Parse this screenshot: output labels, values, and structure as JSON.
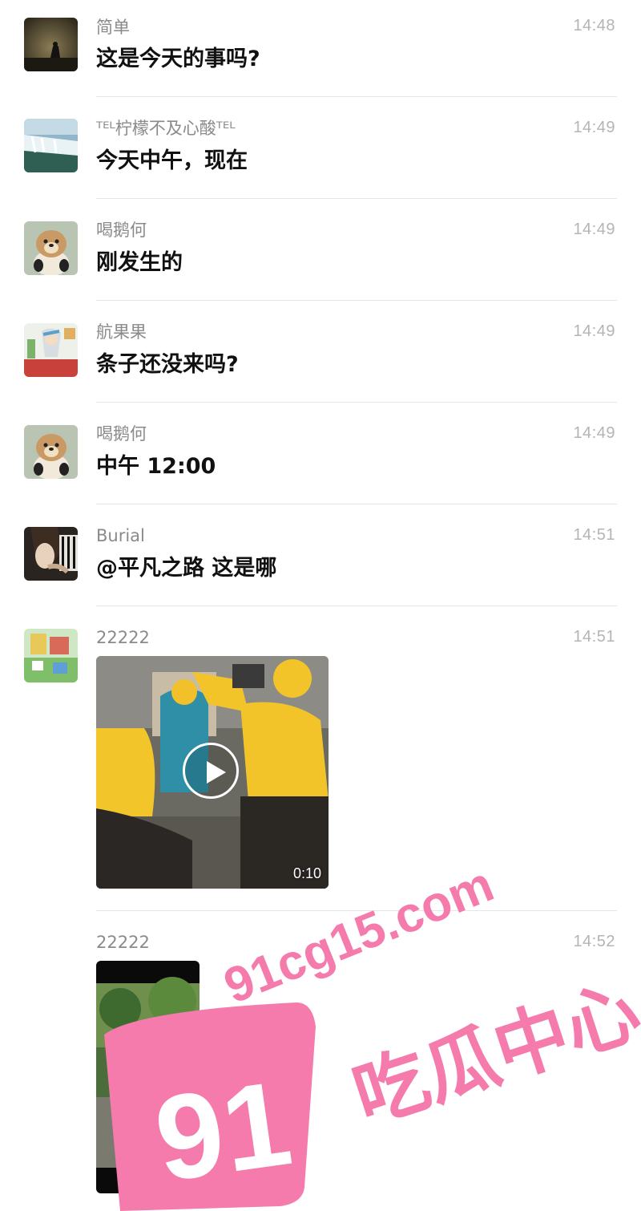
{
  "messages": [
    {
      "sender": "简单",
      "time": "14:48",
      "text": "这是今天的事吗?"
    },
    {
      "sender": "ᵀᴱᴸ柠檬不及心酸ᵀᴱᴸ",
      "time": "14:49",
      "text": "今天中午，现在"
    },
    {
      "sender": "喝鹅何",
      "time": "14:49",
      "text": "刚发生的"
    },
    {
      "sender": "航果果",
      "time": "14:49",
      "text": "条子还没来吗?"
    },
    {
      "sender": "喝鹅何",
      "time": "14:49",
      "text": "中午 12:00"
    },
    {
      "sender": "Burial",
      "time": "14:51",
      "text": "@平凡之路 这是哪"
    },
    {
      "sender": "22222",
      "time": "14:51",
      "video_duration": "0:10"
    },
    {
      "sender": "22222",
      "time": "14:52"
    }
  ],
  "watermark": {
    "url": "91cg15.com",
    "brand": "吃瓜中心",
    "number": "91"
  },
  "colors": {
    "background": "#ffffff",
    "name": "#8a8a8a",
    "time": "#b4b4b4",
    "text": "#111111",
    "divider": "#e6e6e6",
    "watermark": "#f47bac"
  }
}
